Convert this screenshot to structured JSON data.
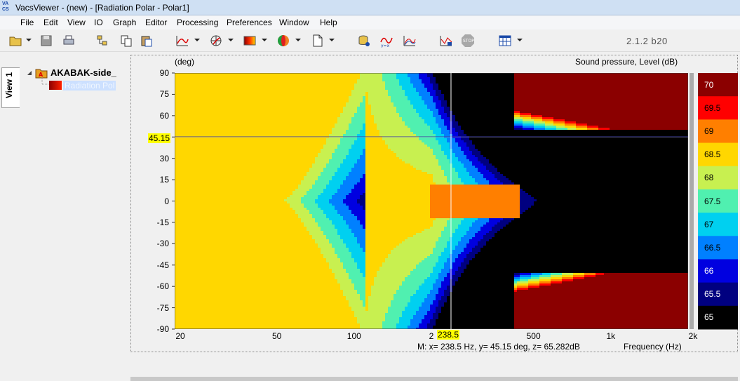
{
  "window": {
    "title": "VacsViewer - (new) - [Radiation Polar - Polar1]",
    "app_icon": "VACS"
  },
  "menu": [
    "File",
    "Edit",
    "View",
    "IO",
    "Graph",
    "Editor",
    "Processing",
    "Preferences",
    "Window",
    "Help"
  ],
  "toolbar": {
    "version": "2.1.2 b20"
  },
  "sidebar": {
    "tab_label": "View 1"
  },
  "tree": {
    "root": "AKABAK-side_",
    "child": "Radiation Pol"
  },
  "chart": {
    "y_unit": "(deg)",
    "z_label": "Sound pressure, Level  (dB)",
    "x_label": "Frequency  (Hz)",
    "status": "M:  x= 238.5 Hz,  y= 45.15 deg, z= 65.282dB",
    "cursor_y_label": "45.15",
    "cursor_x_label": "238.5"
  },
  "chart_data": {
    "type": "heatmap",
    "x_scale": "log",
    "xlim": [
      20,
      2000
    ],
    "ylim": [
      -90,
      90
    ],
    "x_ticks": [
      "20",
      "50",
      "100",
      "2",
      "500",
      "1k",
      "2k"
    ],
    "y_ticks": [
      "90",
      "75",
      "60",
      "45",
      "30",
      "15",
      "0",
      "-15",
      "-30",
      "-45",
      "-60",
      "-75",
      "-90"
    ],
    "colorbar": {
      "labels": [
        "70",
        "69.5",
        "69",
        "68.5",
        "68",
        "67.5",
        "67",
        "66.5",
        "66",
        "65.5",
        "65"
      ],
      "colors": [
        "#8b0000",
        "#ff0000",
        "#ff7f00",
        "#ffd700",
        "#c8f050",
        "#50f0b0",
        "#00d0f0",
        "#0080ff",
        "#0000e0",
        "#000080",
        "#000000"
      ]
    },
    "cursor": {
      "x": 238.5,
      "y": 45.15,
      "z": 65.282
    }
  }
}
